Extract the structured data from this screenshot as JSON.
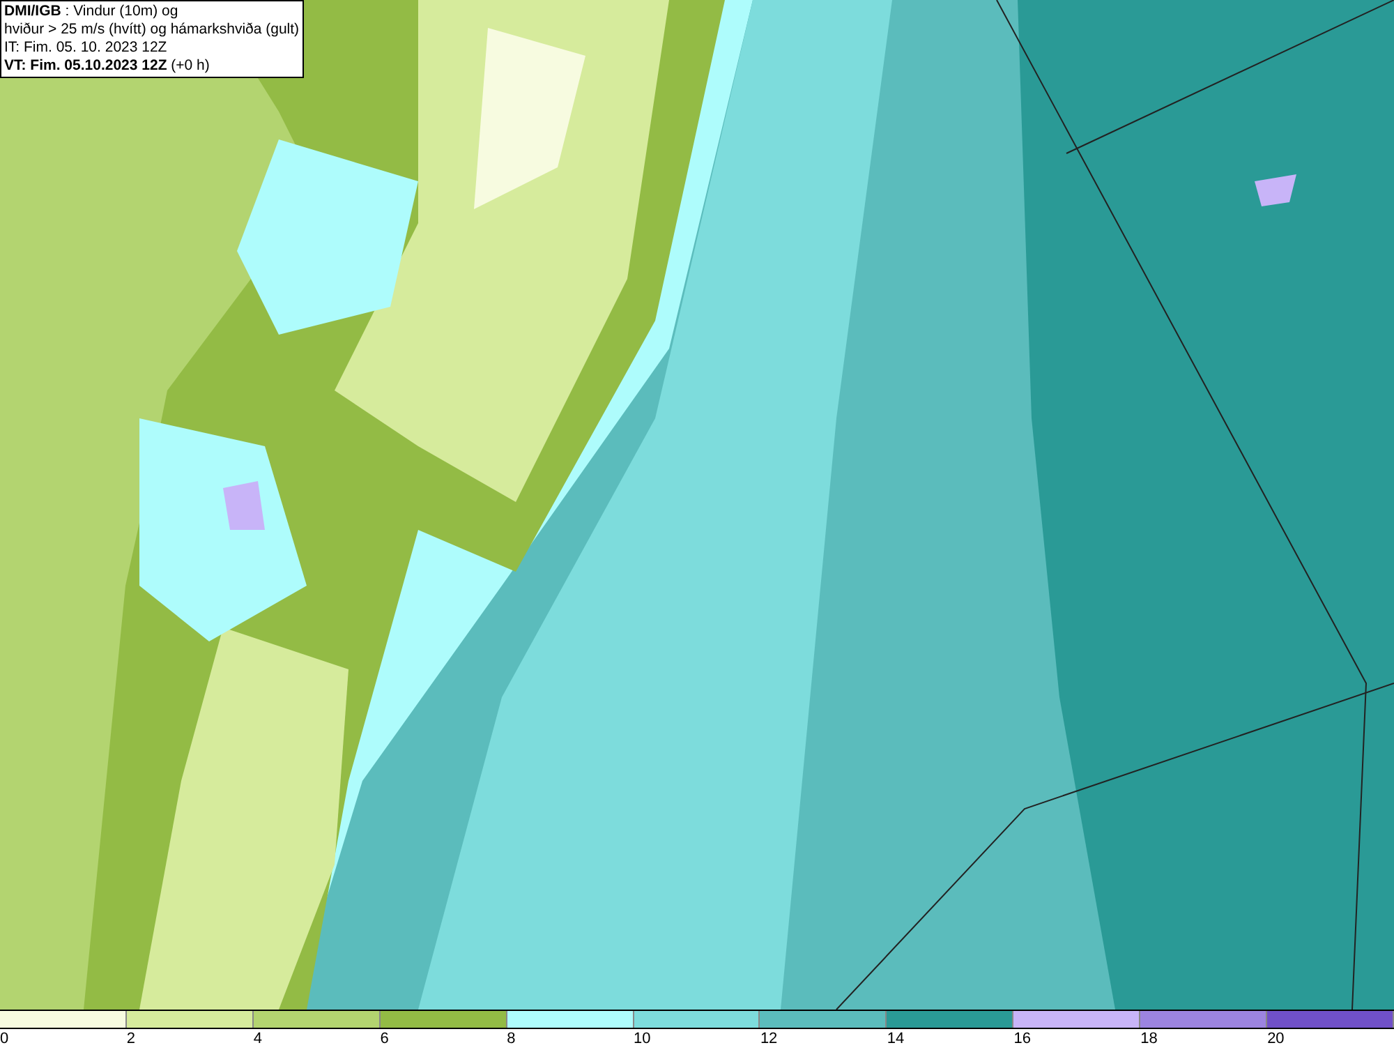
{
  "header": {
    "lines": [
      "**DMI/IGB** : Vindur (10m) og",
      "hviður > 25 m/s (hvítt) og hámarkshviða (gult)",
      "IT: Fim. 05. 10. 2023 12Z",
      "**VT: Fim. 05.10.2023 12Z** (+0 h)"
    ]
  },
  "colorbar": {
    "segments": [
      {
        "color": "#f7fbe0"
      },
      {
        "color": "#d6eb9c"
      },
      {
        "color": "#b3d470"
      },
      {
        "color": "#93bb45"
      },
      {
        "color": "#aefcfc"
      },
      {
        "color": "#7ddcdc"
      },
      {
        "color": "#5bbcbc"
      },
      {
        "color": "#2a9a96"
      },
      {
        "color": "#c8b4f8"
      },
      {
        "color": "#9c84e0"
      },
      {
        "color": "#7050c8"
      }
    ],
    "ticks": [
      "0",
      "2",
      "4",
      "6",
      "8",
      "10",
      "12",
      "14",
      "16",
      "18",
      "20"
    ]
  }
}
